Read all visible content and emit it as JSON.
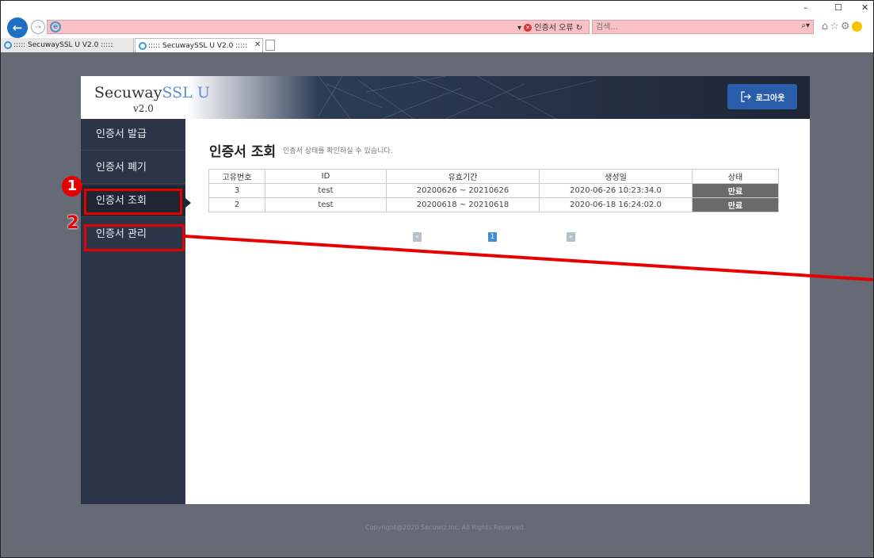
{
  "browser": {
    "cert_error": "인증서 오류",
    "search_placeholder": "검색...",
    "tabs": [
      {
        "label": "::::: SecuwaySSL U V2.0 :::::"
      },
      {
        "label": "::::: SecuwaySSL U V2.0 :::::"
      }
    ],
    "icons": [
      "back-arrow-icon",
      "forward-arrow-icon",
      "ie-icon",
      "refresh-icon",
      "search-icon",
      "home-icon",
      "star-icon",
      "gear-icon",
      "smiley-icon"
    ]
  },
  "header": {
    "logo_part1": "Secuway",
    "logo_part2": "SSL U",
    "logo_version": "v2.0",
    "logout_label": "로그아웃"
  },
  "sidebar": {
    "items": [
      {
        "label": "인증서 발급"
      },
      {
        "label": "인증서 폐기"
      },
      {
        "label": "인증서 조회"
      },
      {
        "label": "인증서 관리"
      }
    ],
    "active": "인증서 조회"
  },
  "main": {
    "title": "인증서 조회",
    "description": "인증서 상태를 확인하실 수 있습니다.",
    "table": {
      "headers": [
        "고유번호",
        "ID",
        "유효기간",
        "생성일",
        "상태"
      ],
      "rows": [
        {
          "no": "3",
          "id": "test",
          "period": "20200626 ~ 20210626",
          "created": "2020-06-26 10:23:34.0",
          "state": "만료"
        },
        {
          "no": "2",
          "id": "test",
          "period": "20200618 ~ 20210618",
          "created": "2020-06-18 16:24:02.0",
          "state": "만료"
        }
      ]
    },
    "pagination": {
      "prev": "«",
      "current": "1",
      "next": "»"
    }
  },
  "footer": {
    "copyright": "Copyright@2020 Secuwiz,Inc. All Rights Reserved."
  },
  "annotations": [
    {
      "number": "1"
    },
    {
      "number": "2"
    }
  ],
  "colors": {
    "page_bg": "#656a75",
    "sidebar_bg": "#2b3547",
    "sidebar_active_bg": "#1e2533",
    "logout_bg": "#2a5eaa",
    "status_bg": "#6a6a6a",
    "annotation": "#e60000",
    "address_bar_error": "#f9c1c4"
  }
}
